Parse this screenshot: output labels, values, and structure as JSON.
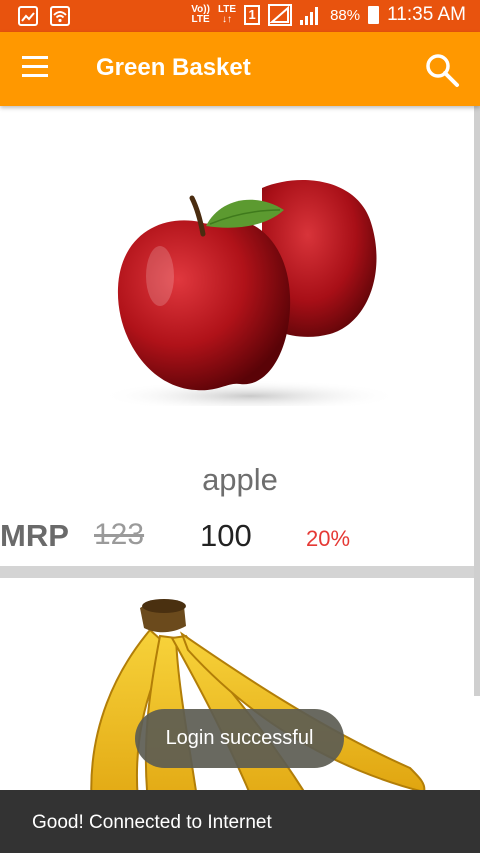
{
  "status_bar": {
    "volte_label_top": "Vo))",
    "volte_label_bottom": "LTE",
    "lte_label": "LTE",
    "sim_number": "1",
    "battery_percent": "88%",
    "time": "11:35 AM"
  },
  "app_bar": {
    "title": "Green Basket"
  },
  "products": [
    {
      "name": "apple",
      "mrp_label": "MRP",
      "old_price": "123",
      "price": "100",
      "discount": "20%",
      "image_icon": "apple-illustration"
    },
    {
      "image_icon": "banana-illustration"
    }
  ],
  "toast": {
    "message": "Login successful"
  },
  "snackbar": {
    "message": "Good! Connected to Internet"
  },
  "colors": {
    "status_bar": "#e8530e",
    "app_bar": "#ff9800",
    "discount": "#e53935",
    "snackbar": "#333333"
  }
}
